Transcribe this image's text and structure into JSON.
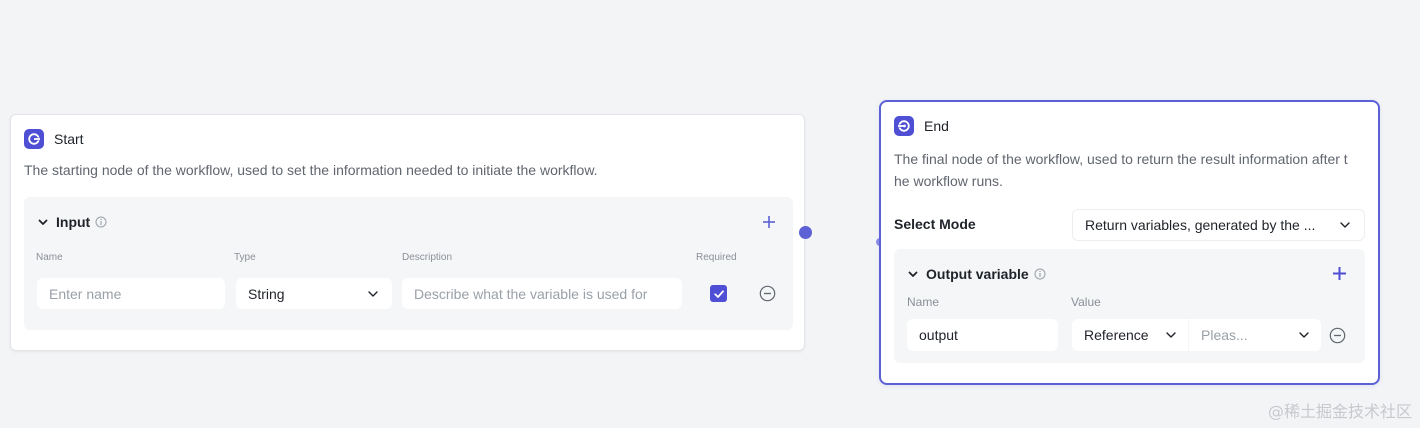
{
  "start": {
    "title": "Start",
    "description": "The starting node of the workflow, used to set the information needed to initiate the workflow.",
    "input_section": {
      "title": "Input",
      "columns": {
        "name": "Name",
        "type": "Type",
        "description": "Description",
        "required": "Required"
      },
      "row": {
        "name_placeholder": "Enter name",
        "type_value": "String",
        "description_placeholder": "Describe what the variable is used for",
        "required": true
      }
    }
  },
  "end": {
    "title": "End",
    "description_line1": "The final node of the workflow, used to return the result information after t",
    "description_line2": "he workflow runs.",
    "select_mode_label": "Select Mode",
    "select_mode_value": "Return variables, generated by the ...",
    "output_section": {
      "title": "Output variable",
      "columns": {
        "name": "Name",
        "value": "Value"
      },
      "row": {
        "name_value": "output",
        "value_type": "Reference",
        "value_placeholder": "Pleas..."
      }
    }
  },
  "watermark": "@稀土掘金技术社区",
  "colors": {
    "accent": "#4e4fd4",
    "selected_border": "#5c62d6",
    "canvas": "#f3f4f6"
  },
  "icons": {
    "start_node_icon": "start-node-icon",
    "end_node_icon": "end-node-icon",
    "chevron": "chevron-down-icon",
    "info": "info-icon",
    "plus": "plus-icon",
    "minus": "minus-circle-icon",
    "check": "checkmark-icon"
  }
}
